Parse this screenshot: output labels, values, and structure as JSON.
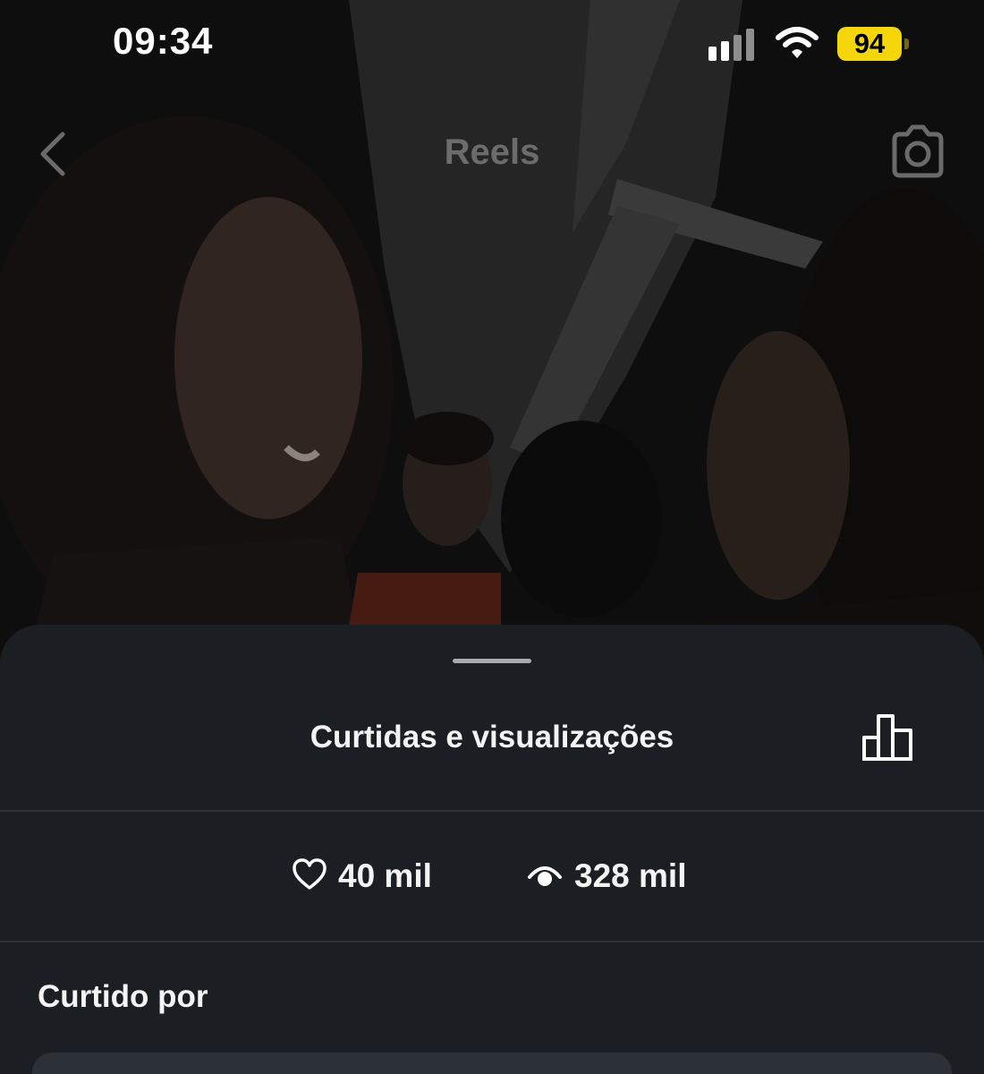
{
  "status_bar": {
    "time": "09:34",
    "battery": "94",
    "icons": [
      "signal-icon",
      "wifi-icon",
      "battery-icon"
    ]
  },
  "header": {
    "title": "Reels",
    "icons": [
      "back-icon",
      "camera-icon"
    ]
  },
  "sheet": {
    "title": "Curtidas e visualizações",
    "insights_icon": "bar-chart-icon",
    "stats": {
      "likes": "40 mil",
      "likes_icon": "heart-icon",
      "views": "328 mil",
      "views_icon": "eye-icon"
    },
    "section_heading": "Curtido por"
  },
  "colors": {
    "sheet_background": "#1b1f23",
    "battery_accent": "#f5d60a",
    "divider": "#2c3136"
  }
}
